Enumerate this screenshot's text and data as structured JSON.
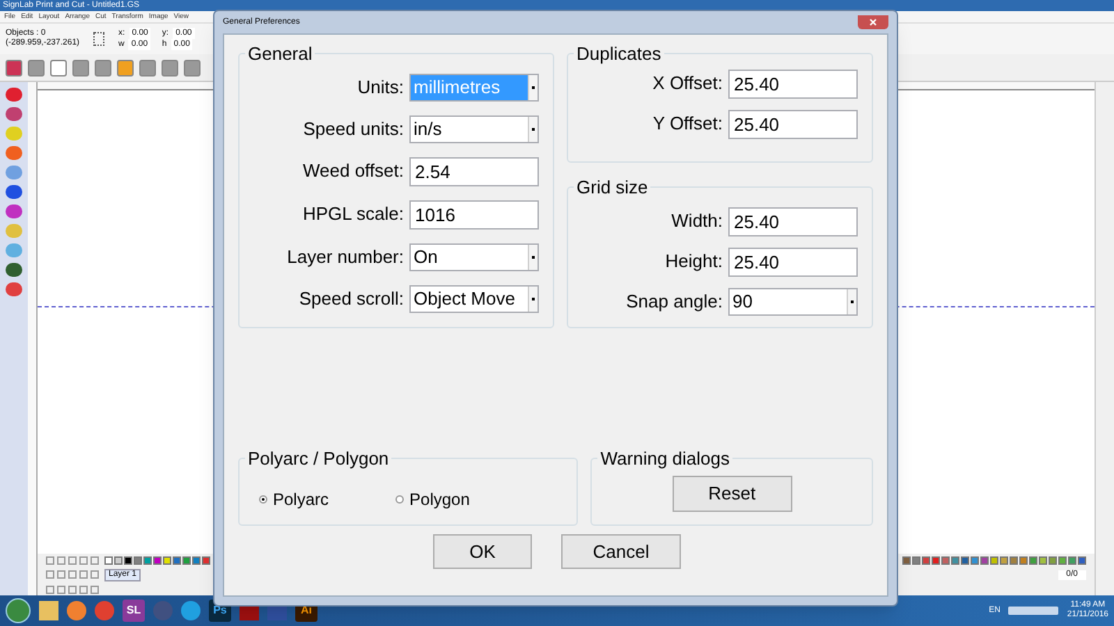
{
  "app": {
    "title": "SignLab Print and Cut - Untitled1.GS",
    "menu": [
      "File",
      "Edit",
      "Layout",
      "Arrange",
      "Cut",
      "Transform",
      "Image",
      "View"
    ],
    "objects": "Objects : 0",
    "coords": "(-289.959,-237.261)",
    "fields": [
      {
        "label": "x:",
        "value": "0.00"
      },
      {
        "label": "y:",
        "value": "0.00"
      },
      {
        "label": "w",
        "value": "0.00"
      },
      {
        "label": "h",
        "value": "0.00"
      }
    ],
    "page": "0/0",
    "layer": "Layer 1"
  },
  "dialog": {
    "title": "General Preferences",
    "general": {
      "title": "General",
      "fields": [
        {
          "label": "Units:",
          "value": "millimetres",
          "kind": "dropdown",
          "focused": true
        },
        {
          "label": "Speed units:",
          "value": "in/s",
          "kind": "dropdown",
          "focused": false
        },
        {
          "label": "Weed offset:",
          "value": "2.54",
          "kind": "text",
          "focused": false
        },
        {
          "label": "HPGL scale:",
          "value": "1016",
          "kind": "text",
          "focused": false
        },
        {
          "label": "Layer number:",
          "value": "On",
          "kind": "dropdown",
          "focused": false
        },
        {
          "label": "Speed scroll:",
          "value": "Object Move",
          "kind": "dropdown",
          "focused": false
        }
      ]
    },
    "duplicates": {
      "title": "Duplicates",
      "fields": [
        {
          "label": "X Offset:",
          "value": "25.40",
          "kind": "text",
          "focused": false
        },
        {
          "label": "Y Offset:",
          "value": "25.40",
          "kind": "text",
          "focused": false
        }
      ]
    },
    "grid": {
      "title": "Grid size",
      "fields": [
        {
          "label": "Width:",
          "value": "25.40",
          "kind": "text",
          "focused": false
        },
        {
          "label": "Height:",
          "value": "25.40",
          "kind": "text",
          "focused": false
        },
        {
          "label": "Snap angle:",
          "value": "90",
          "kind": "dropdown",
          "focused": false
        }
      ]
    },
    "polyarc": {
      "title": "Polyarc / Polygon",
      "options": [
        {
          "label": "Polyarc",
          "selected": true
        },
        {
          "label": "Polygon",
          "selected": false
        }
      ]
    },
    "warning": {
      "title": "Warning dialogs",
      "button": "Reset"
    },
    "buttons": [
      "OK",
      "Cancel"
    ]
  },
  "taskbar": {
    "apps": [
      "SL",
      "Ps",
      "Ai"
    ],
    "language": "EN",
    "time": "11:49 AM",
    "date": "21/11/2016"
  }
}
